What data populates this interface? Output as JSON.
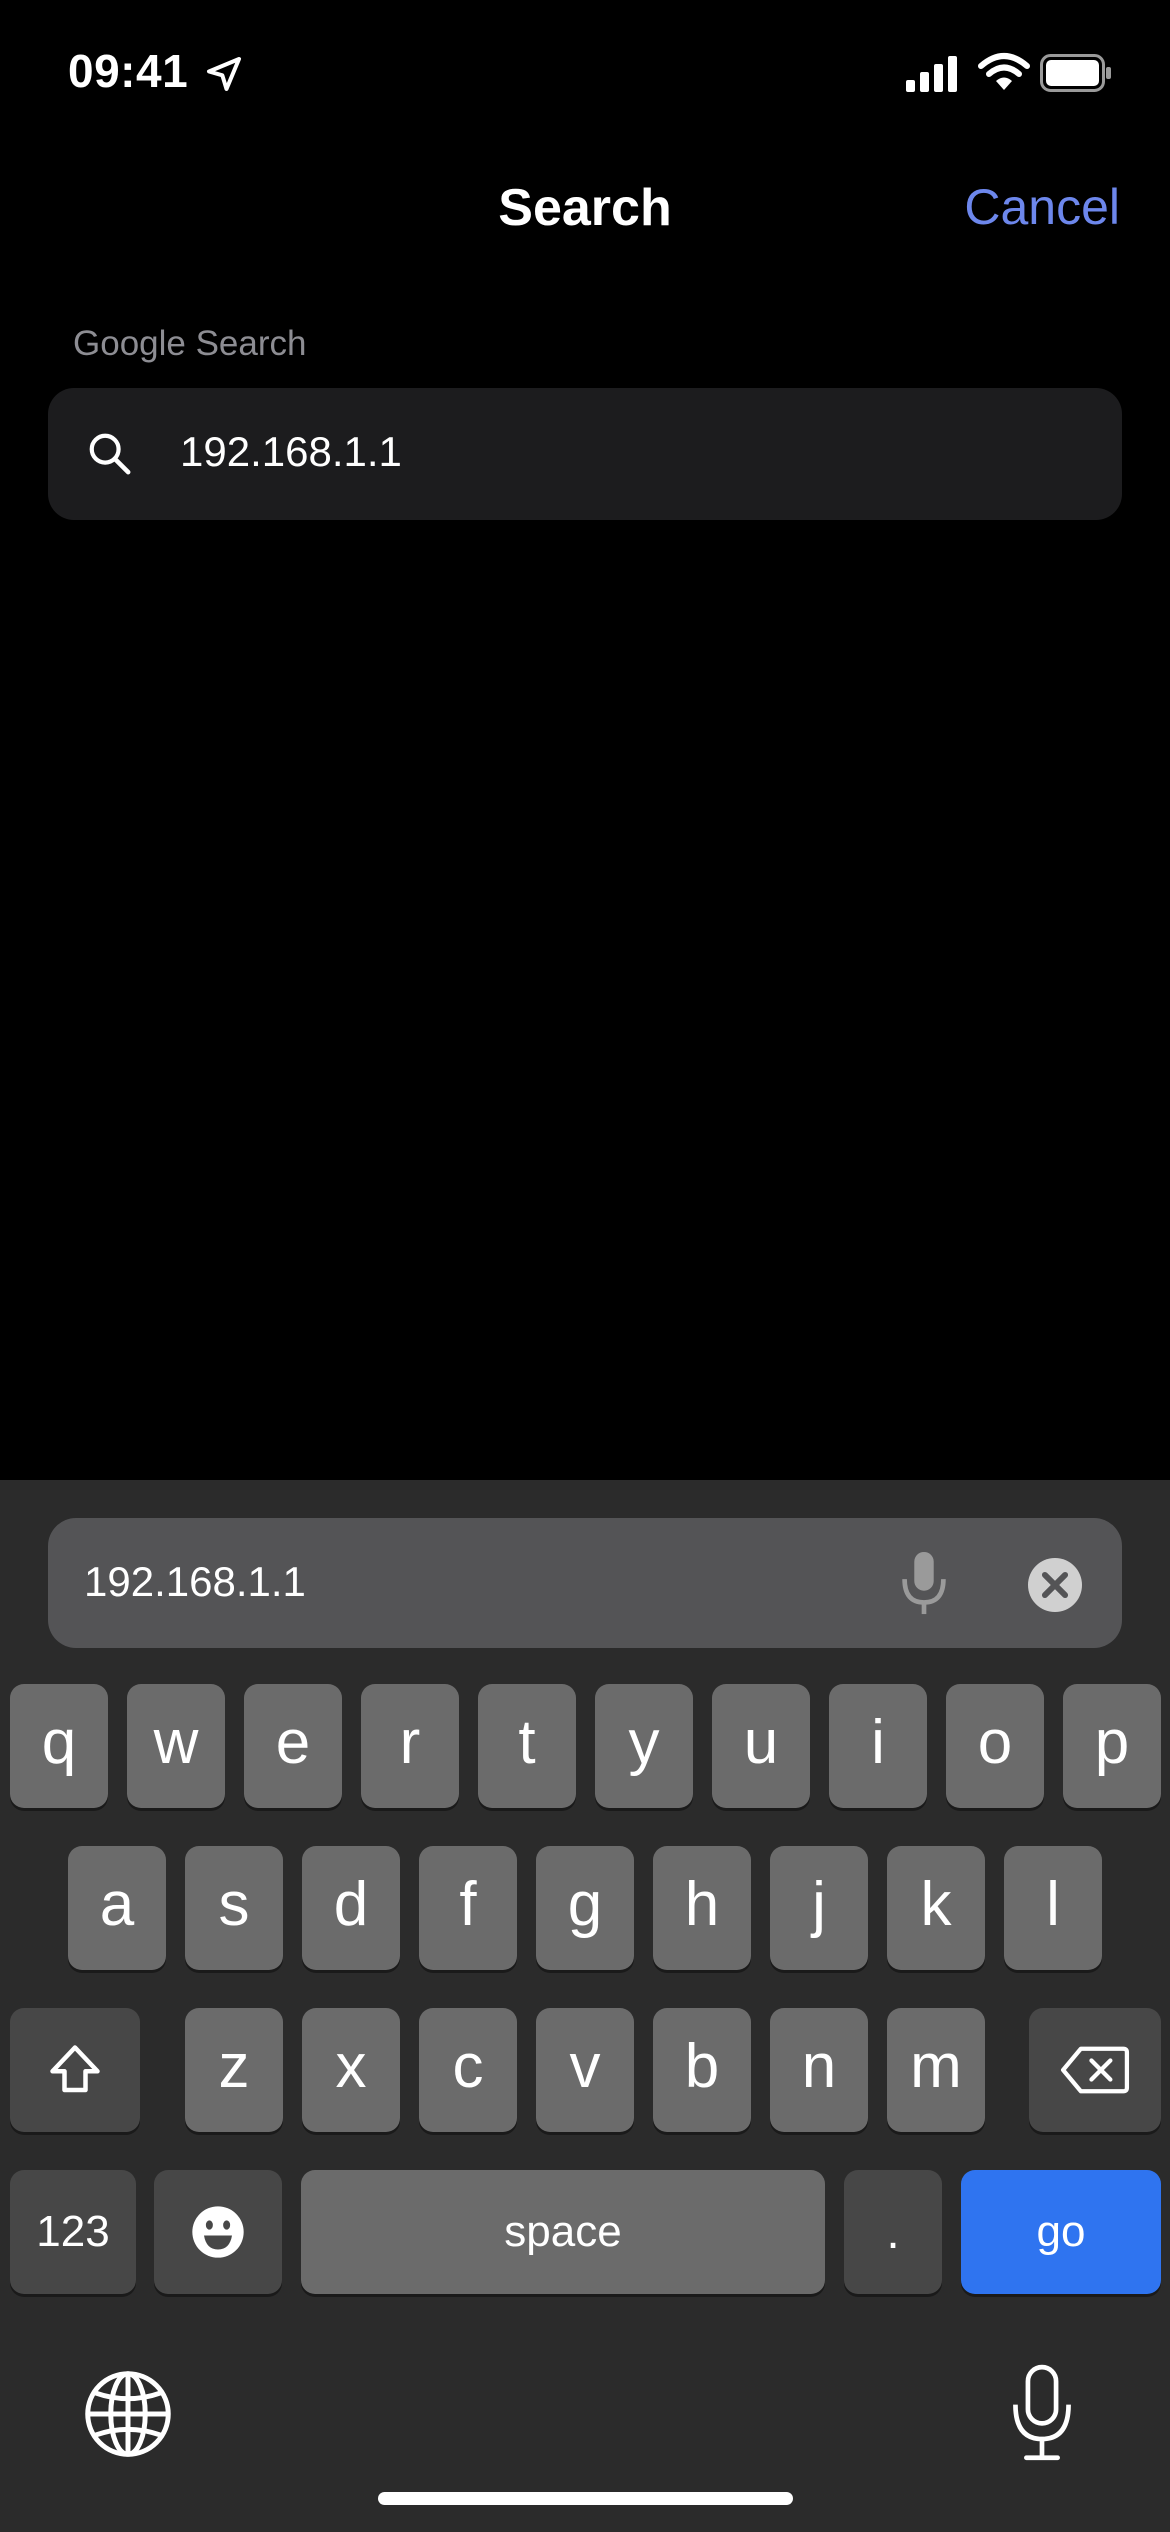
{
  "status_bar": {
    "time": "09:41"
  },
  "header": {
    "title": "Search",
    "cancel_label": "Cancel"
  },
  "section_label": "Google Search",
  "search": {
    "query": "192.168.1.1"
  },
  "keyboard": {
    "input_value": "192.168.1.1",
    "row1": [
      "q",
      "w",
      "e",
      "r",
      "t",
      "y",
      "u",
      "i",
      "o",
      "p"
    ],
    "row2": [
      "a",
      "s",
      "d",
      "f",
      "g",
      "h",
      "j",
      "k",
      "l"
    ],
    "row3": [
      "z",
      "x",
      "c",
      "v",
      "b",
      "n",
      "m"
    ],
    "numbers_label": "123",
    "space_label": "space",
    "period_label": ".",
    "go_label": "go"
  },
  "colors": {
    "accent": "#6d87ec",
    "go_key": "#2f74f0"
  },
  "icons": [
    "location-arrow-icon",
    "cellular-signal-icon",
    "wifi-icon",
    "battery-icon",
    "search-icon",
    "microphone-icon",
    "clear-icon",
    "shift-icon",
    "backspace-icon",
    "emoji-icon",
    "globe-icon"
  ]
}
